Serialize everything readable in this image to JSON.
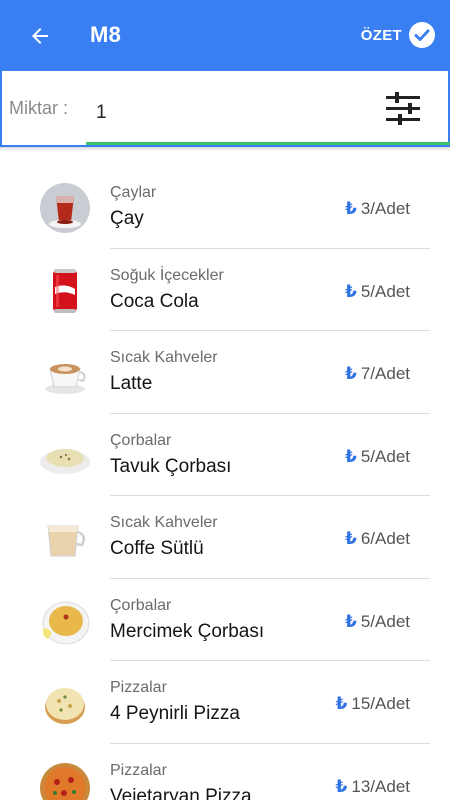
{
  "appbar": {
    "title": "M8",
    "summary_label": "ÖZET",
    "color": "#3a7ff2"
  },
  "quantity": {
    "label": "Miktar :",
    "value": "1"
  },
  "currency_symbol": "₺",
  "products": [
    {
      "category": "Çaylar",
      "name": "Çay",
      "price": "3/Adet",
      "icon": "tea-glass-icon"
    },
    {
      "category": "Soğuk İçecekler",
      "name": "Coca Cola",
      "price": "5/Adet",
      "icon": "cola-can-icon"
    },
    {
      "category": "Sıcak Kahveler",
      "name": "Latte",
      "price": "7/Adet",
      "icon": "latte-cup-icon"
    },
    {
      "category": "Çorbalar",
      "name": "Tavuk Çorbası",
      "price": "5/Adet",
      "icon": "chicken-soup-icon"
    },
    {
      "category": "Sıcak Kahveler",
      "name": "Coffe Sütlü",
      "price": "6/Adet",
      "icon": "milk-coffee-icon"
    },
    {
      "category": "Çorbalar",
      "name": "Mercimek Çorbası",
      "price": "5/Adet",
      "icon": "lentil-soup-icon"
    },
    {
      "category": "Pizzalar",
      "name": "4 Peynirli Pizza",
      "price": "15/Adet",
      "icon": "cheese-pizza-icon"
    },
    {
      "category": "Pizzalar",
      "name": "Vejetaryan Pizza",
      "price": "13/Adet",
      "icon": "veggie-pizza-icon"
    }
  ]
}
